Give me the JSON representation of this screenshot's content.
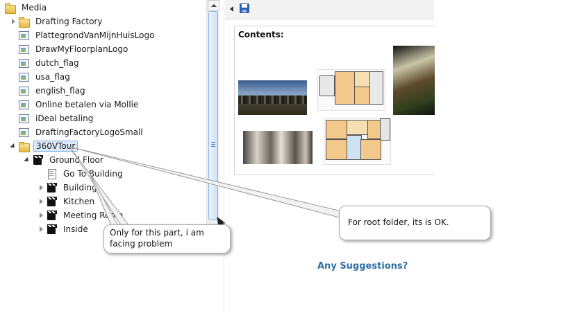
{
  "tree": {
    "root": "Media",
    "items": [
      {
        "label": "Drafting Factory",
        "icon": "folder-icon"
      },
      {
        "label": "PlattegrondVanMijnHuisLogo",
        "icon": "image-icon"
      },
      {
        "label": "DrawMyFloorplanLogo",
        "icon": "image-icon"
      },
      {
        "label": "dutch_flag",
        "icon": "image-icon"
      },
      {
        "label": "usa_flag",
        "icon": "image-icon"
      },
      {
        "label": "english_flag",
        "icon": "image-icon"
      },
      {
        "label": "Online betalen via Mollie",
        "icon": "image-icon"
      },
      {
        "label": "iDeal betaling",
        "icon": "image-icon"
      },
      {
        "label": "DraftingFactoryLogoSmall",
        "icon": "image-icon"
      },
      {
        "label": "360VTour",
        "icon": "folder-icon"
      },
      {
        "label": "Ground Floor",
        "icon": "clapper-icon"
      },
      {
        "label": "Go To Building",
        "icon": "document-icon"
      },
      {
        "label": "Building",
        "icon": "clapper-icon"
      },
      {
        "label": "Kitchen",
        "icon": "clapper-icon"
      },
      {
        "label": "Meeting Room",
        "icon": "clapper-icon"
      },
      {
        "label": "Inside",
        "icon": "clapper-icon"
      }
    ]
  },
  "contents": {
    "title": "Contents:"
  },
  "callouts": {
    "left": "Only for this part, i am facing problem",
    "right": "For root folder, its is OK."
  },
  "question": "Any Suggestions?"
}
